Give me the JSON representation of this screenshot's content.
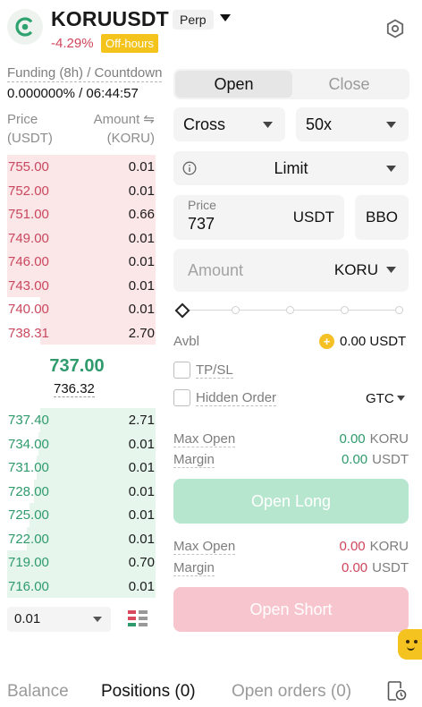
{
  "header": {
    "symbol": "KORUUSDT",
    "contract_type": "Perp",
    "change": "-4.29%",
    "status_badge": "Off-hours"
  },
  "funding": {
    "label": "Funding (8h) / Countdown",
    "value": "0.000000% / 06:44:57"
  },
  "orderbook": {
    "price_header": [
      "Price",
      "(USDT)"
    ],
    "amount_header": [
      "Amount ⇋",
      "(KORU)"
    ],
    "asks": [
      {
        "price": "755.00",
        "amount": "0.01",
        "depth": 1.0
      },
      {
        "price": "752.00",
        "amount": "0.01",
        "depth": 1.0
      },
      {
        "price": "751.00",
        "amount": "0.66",
        "depth": 1.0
      },
      {
        "price": "749.00",
        "amount": "0.01",
        "depth": 1.0
      },
      {
        "price": "746.00",
        "amount": "0.01",
        "depth": 1.0
      },
      {
        "price": "743.00",
        "amount": "0.01",
        "depth": 1.0
      },
      {
        "price": "740.00",
        "amount": "0.01",
        "depth": 0.78
      },
      {
        "price": "738.31",
        "amount": "2.70",
        "depth": 0.78
      }
    ],
    "last_price": "737.00",
    "mark_price": "736.32",
    "bids": [
      {
        "price": "737.40",
        "amount": "2.71",
        "depth": 0.78
      },
      {
        "price": "734.00",
        "amount": "0.01",
        "depth": 0.79
      },
      {
        "price": "731.00",
        "amount": "0.01",
        "depth": 0.8
      },
      {
        "price": "728.00",
        "amount": "0.01",
        "depth": 0.82
      },
      {
        "price": "725.00",
        "amount": "0.01",
        "depth": 0.85
      },
      {
        "price": "722.00",
        "amount": "0.01",
        "depth": 0.87
      },
      {
        "price": "719.00",
        "amount": "0.70",
        "depth": 1.0
      },
      {
        "price": "716.00",
        "amount": "0.01",
        "depth": 1.0
      }
    ],
    "depth_step": "0.01"
  },
  "order_form": {
    "tabs": {
      "open": "Open",
      "close": "Close"
    },
    "margin_mode": "Cross",
    "leverage": "50x",
    "order_type": "Limit",
    "price_label": "Price",
    "price_value": "737",
    "price_unit": "USDT",
    "bbo_label": "BBO",
    "amount_placeholder": "Amount",
    "amount_unit": "KORU",
    "avbl_label": "Avbl",
    "avbl_value": "0.00 USDT",
    "tpsl_label": "TP/SL",
    "hidden_order_label": "Hidden Order",
    "time_in_force": "GTC",
    "long": {
      "max_open_label": "Max Open",
      "max_open_value": "0.00",
      "max_open_unit": "KORU",
      "margin_label": "Margin",
      "margin_value": "0.00",
      "margin_unit": "USDT",
      "button": "Open Long"
    },
    "short": {
      "max_open_label": "Max Open",
      "max_open_value": "0.00",
      "max_open_unit": "KORU",
      "margin_label": "Margin",
      "margin_value": "0.00",
      "margin_unit": "USDT",
      "button": "Open Short"
    }
  },
  "bottom_tabs": {
    "balance": "Balance",
    "positions": "Positions (0)",
    "open_orders": "Open orders (0)"
  },
  "colors": {
    "ask": "#c9485e",
    "bid": "#2f9a6c",
    "badge": "#f4c41c"
  }
}
